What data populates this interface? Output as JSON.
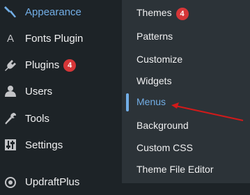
{
  "sidebar": {
    "items": [
      {
        "label": "Appearance",
        "icon": "paintbrush-icon",
        "current": true
      },
      {
        "label": "Fonts Plugin",
        "icon": "letter-a-icon"
      },
      {
        "label": "Plugins",
        "icon": "plugin-icon",
        "badge": "4"
      },
      {
        "label": "Users",
        "icon": "user-icon"
      },
      {
        "label": "Tools",
        "icon": "wrench-icon"
      },
      {
        "label": "Settings",
        "icon": "settings-sliders-icon"
      },
      {
        "label": "UpdraftPlus",
        "icon": "updraftplus-icon"
      }
    ]
  },
  "submenu": {
    "items": [
      {
        "label": "Themes",
        "badge": "4"
      },
      {
        "label": "Patterns"
      },
      {
        "label": "Customize"
      },
      {
        "label": "Widgets"
      },
      {
        "label": "Menus",
        "current": true
      },
      {
        "label": "Background"
      },
      {
        "label": "Custom CSS"
      },
      {
        "label": "Theme File Editor"
      }
    ]
  },
  "colors": {
    "sidebar_bg": "#1d2327",
    "submenu_bg": "#2c3338",
    "accent": "#72aee6",
    "badge": "#d63638",
    "annotation_arrow": "#d11a1a"
  }
}
